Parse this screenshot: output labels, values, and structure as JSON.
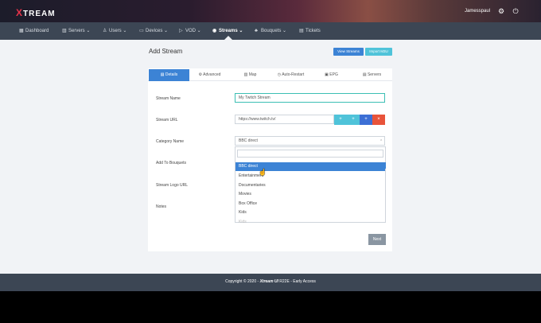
{
  "header": {
    "brand_x": "X",
    "brand_rest": "TREAM",
    "username": "Jamesspaul",
    "settings_icon": "gear-icon",
    "power_icon": "power-icon"
  },
  "nav": {
    "items": [
      {
        "label": "Dashboard",
        "icon": "dashboard-icon"
      },
      {
        "label": "Servers",
        "icon": "server-icon"
      },
      {
        "label": "Users",
        "icon": "user-icon"
      },
      {
        "label": "Devices",
        "icon": "devices-icon"
      },
      {
        "label": "VOD",
        "icon": "vod-icon"
      },
      {
        "label": "Streams",
        "icon": "streams-icon"
      },
      {
        "label": "Bouquets",
        "icon": "bouquets-icon"
      },
      {
        "label": "Tickets",
        "icon": "tickets-icon"
      }
    ],
    "active": "Streams"
  },
  "page": {
    "title": "Add Stream",
    "view_streams_label": "View Streams",
    "import_m3u_label": "Import M3U"
  },
  "tabs": [
    "Details",
    "Advanced",
    "Map",
    "Auto-Restart",
    "EPG",
    "Servers"
  ],
  "form": {
    "stream_name_label": "Stream Name",
    "stream_name_value": "My Twitch Stream",
    "stream_url_label": "Stream URL",
    "stream_url_value": "https://www.twitch.tv/",
    "category_label": "Category Name",
    "category_value": "BBC direct",
    "bouquets_label": "Add To Bouquets",
    "logo_label": "Stream Logo URL",
    "notes_label": "Notes"
  },
  "dropdown": {
    "options": [
      "BBC direct",
      "Entertainment",
      "Documentaries",
      "Movies",
      "Box Office",
      "Kids",
      "Kids"
    ],
    "selected": "BBC direct"
  },
  "url_buttons": [
    {
      "label": "+",
      "color": "#4fc3d9"
    },
    {
      "label": "+",
      "color": "#4fc3d9"
    },
    {
      "label": "+",
      "color": "#3c6fd5"
    },
    {
      "label": "×",
      "color": "#e8533a"
    }
  ],
  "next_label": "Next",
  "footer": {
    "prefix": "Copyright © 2020 - ",
    "brand": "Xtream UI",
    "suffix": " R22E - Early Access"
  },
  "colors": {
    "accent": "#3c83d5",
    "nav_bg": "#3c4654",
    "view_streams_bg": "#3c83d5",
    "import_m3u_bg": "#4fc3d9"
  }
}
